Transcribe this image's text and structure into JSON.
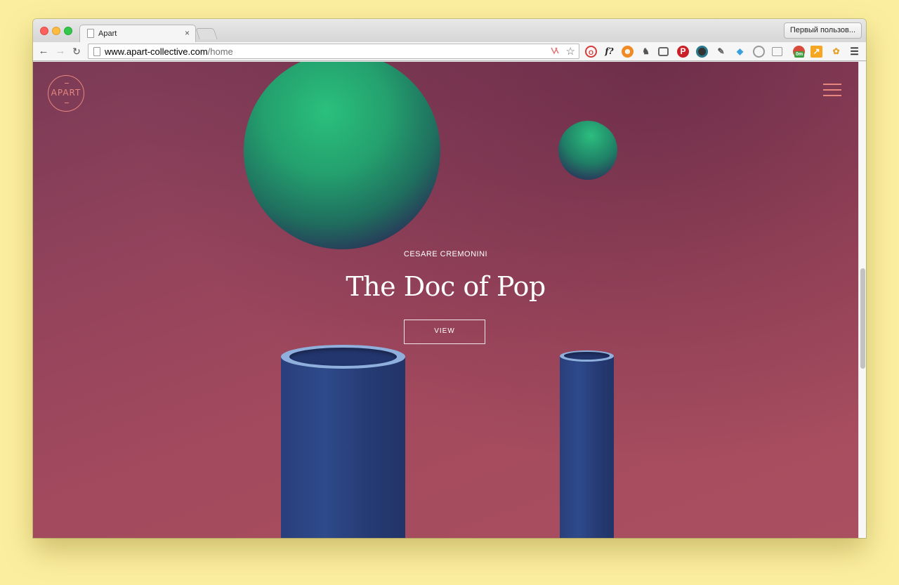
{
  "browser": {
    "tab_title": "Apart",
    "tab_close": "×",
    "profile_button": "Первый пользов...",
    "nav": {
      "back": "←",
      "forward": "→",
      "reload": "↻"
    },
    "url_host": "www.apart-collective.com",
    "url_path": "/home",
    "omnibox_star": "☆",
    "extensions": [
      "opera-icon",
      "font-icon",
      "fire-icon",
      "evernote-icon",
      "pocket-icon",
      "pinterest-icon",
      "camera-icon",
      "eyedropper-icon",
      "diamond-icon",
      "loader-icon",
      "reader-icon",
      "badge-icon",
      "chart-icon",
      "flower-icon",
      "menu-icon"
    ],
    "extension_badge": "0m"
  },
  "page": {
    "logo_text": "APART",
    "hero_subtitle": "CESARE CREMONINI",
    "hero_title": "The Doc of Pop",
    "view_button": "VIEW"
  },
  "colors": {
    "accent": "#e6867f",
    "background": "#a44a5e",
    "sphere": "#2ac07c",
    "tube": "#2e4a8a"
  }
}
